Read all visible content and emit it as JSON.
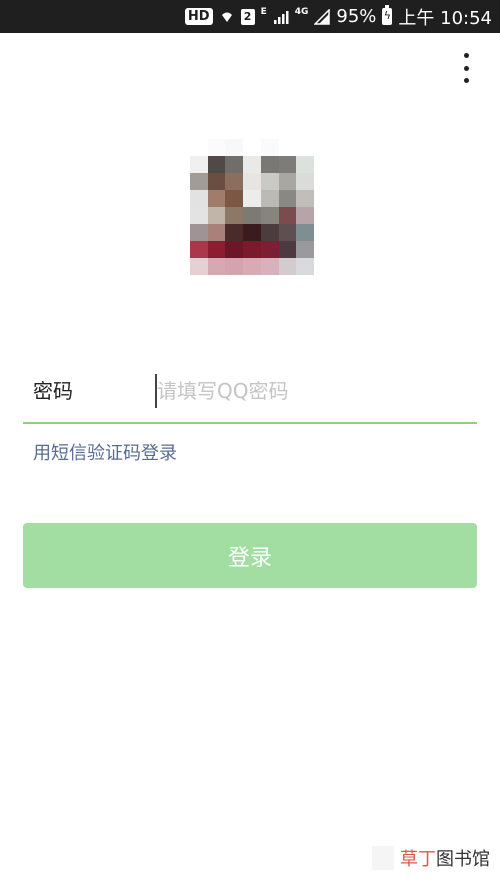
{
  "status_bar": {
    "hd": "HD",
    "sim": "2",
    "network_type_e": "E",
    "network_type_4g": "4G",
    "battery": "95%",
    "time": "上午 10:54"
  },
  "login": {
    "password_label": "密码",
    "password_placeholder": "请填写QQ密码",
    "sms_link": "用短信验证码登录",
    "login_button": "登录"
  },
  "watermark": {
    "red": "草丁",
    "dark": "图书馆"
  },
  "colors": {
    "accent_green": "#8dd27f",
    "button_disabled": "#a2dea1",
    "link": "#586c93"
  },
  "icons": [
    "wifi-icon",
    "signal-icon",
    "battery-icon",
    "more-vertical-icon"
  ]
}
